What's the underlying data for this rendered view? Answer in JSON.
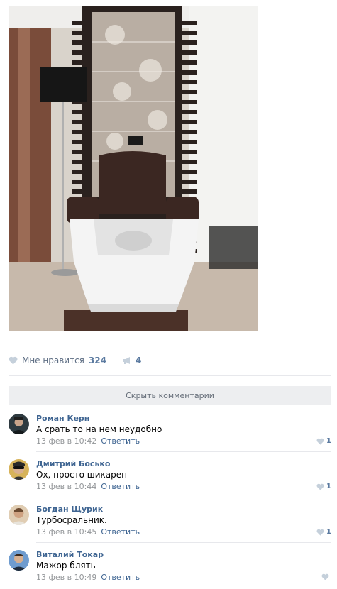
{
  "post": {
    "likes_label": "Мне нравится",
    "likes_count": "324",
    "shares_count": "4",
    "hide_comments_label": "Скрыть комментарии"
  },
  "comments": [
    {
      "author": "Роман Керн",
      "text": "А срать то на нем неудобно",
      "date": "13 фев в 10:42",
      "reply": "Ответить",
      "likes": "1"
    },
    {
      "author": "Дмитрий Босько",
      "text": "Ох, просто шикарен",
      "date": "13 фев в 10:44",
      "reply": "Ответить",
      "likes": "1"
    },
    {
      "author": "Богдан Щурик",
      "text": "Турбосральник.",
      "date": "13 фев в 10:45",
      "reply": "Ответить",
      "likes": "1"
    },
    {
      "author": "Виталий Токар",
      "text": "Мажор блять",
      "date": "13 фев в 10:49",
      "reply": "Ответить",
      "likes": ""
    }
  ],
  "colors": {
    "link": "#3f6592",
    "meta": "#939699",
    "accent": "#5b7aa0"
  }
}
